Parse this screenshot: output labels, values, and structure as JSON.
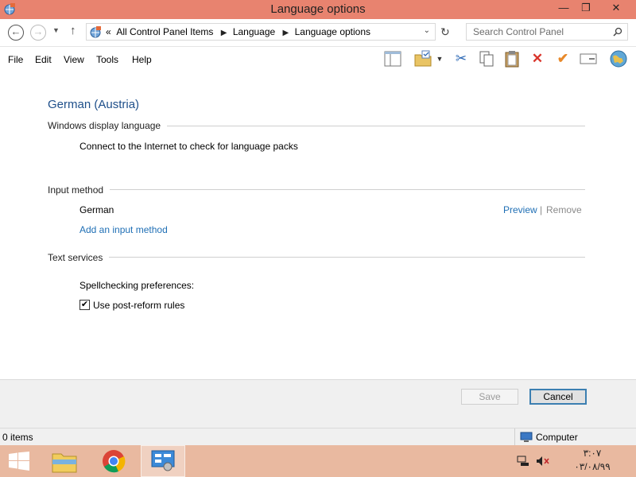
{
  "window": {
    "title": "Language options",
    "minimize_glyph": "—",
    "maximize_glyph": "❐",
    "close_glyph": "✕"
  },
  "address": {
    "overflow": "«",
    "crumbs": [
      "All Control Panel Items",
      "Language",
      "Language options"
    ],
    "search_placeholder": "Search Control Panel"
  },
  "menu": [
    "File",
    "Edit",
    "View",
    "Tools",
    "Help"
  ],
  "content": {
    "heading": "German (Austria)",
    "display_section": {
      "title": "Windows display language",
      "text": "Connect to the Internet to check for language packs"
    },
    "input_section": {
      "title": "Input method",
      "method_name": "German",
      "preview_label": "Preview",
      "separator": "|",
      "remove_label": "Remove",
      "add_label": "Add an input method"
    },
    "text_section": {
      "title": "Text services",
      "spell_label": "Spellchecking preferences:",
      "checkbox_label": "Use post-reform rules",
      "checkbox_checked": true
    }
  },
  "buttons": {
    "save": "Save",
    "cancel": "Cancel"
  },
  "status": {
    "items": "0 items",
    "computer": "Computer"
  },
  "taskbar": {
    "time": "۳:۰۷",
    "date": "۰۳/۰۸/۹۹"
  },
  "colors": {
    "titlebar": "#e8836f",
    "taskbar": "#e9b9a0",
    "link": "#1f6fb5",
    "heading": "#1e4f8a"
  }
}
